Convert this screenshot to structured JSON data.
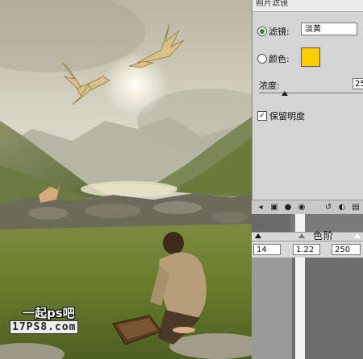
{
  "panel": {
    "title": "照片滤镜",
    "filter_label": "滤镜:",
    "filter_value": "淡黄",
    "color_label": "颜色:",
    "color_swatch": "#ffcc00",
    "density_label": "浓度:",
    "density_value": "25",
    "density_level_percent": 25,
    "preserve_label": "保留明度",
    "preserve_checked": true
  },
  "levels": {
    "title": "色阶",
    "input_black": "14",
    "input_gamma": "1.22",
    "input_white": "250"
  },
  "watermark": {
    "line1": "一起ps吧",
    "line2": "17PS8.com"
  },
  "icons": [
    "chevron-left-icon",
    "adjustment-icon",
    "layer-icon",
    "eye-icon",
    "visibility-icon",
    "refresh-icon",
    "trash-icon"
  ]
}
